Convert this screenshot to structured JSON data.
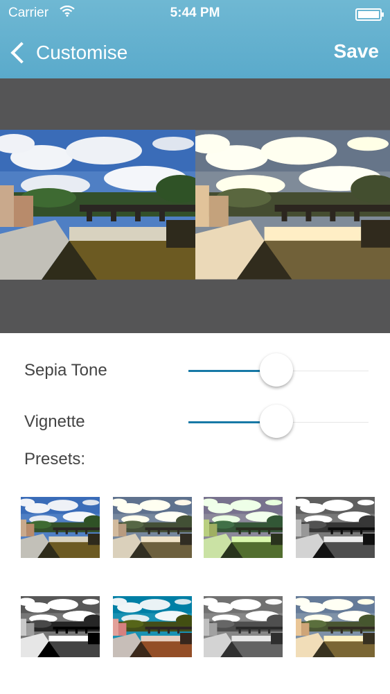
{
  "status_bar": {
    "carrier": "Carrier",
    "time": "5:44 PM"
  },
  "nav": {
    "title": "Customise",
    "save_label": "Save"
  },
  "sliders": [
    {
      "label": "Sepia Tone",
      "value": 0.5
    },
    {
      "label": "Vignette",
      "value": 0.5
    }
  ],
  "presets_label": "Presets:",
  "colors": {
    "header": "#5aaacb",
    "slider_accent": "#1779a6",
    "preview_bg": "#555556"
  }
}
